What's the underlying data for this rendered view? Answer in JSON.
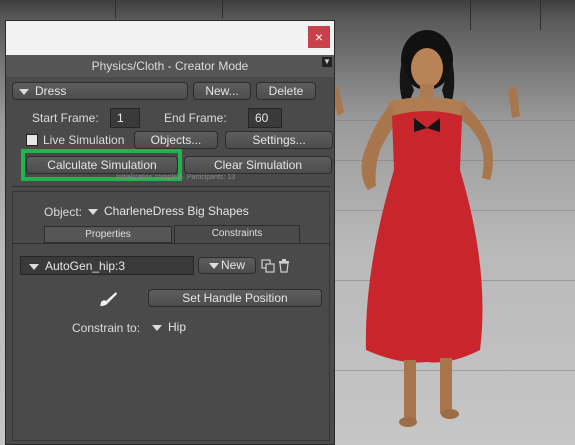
{
  "dialog": {
    "title": "Physics/Cloth - Creator Mode",
    "close_glyph": "×",
    "cloth_name": "Dress",
    "new_label": "New...",
    "delete_label": "Delete",
    "start_frame_label": "Start Frame:",
    "start_frame_value": "1",
    "end_frame_label": "End Frame:",
    "end_frame_value": "60",
    "live_simulation_label": "Live Simulation",
    "objects_label": "Objects...",
    "settings_label": "Settings...",
    "calculate_label": "Calculate Simulation",
    "clear_label": "Clear Simulation",
    "status_text": "Initialization complete. Participants: 13",
    "object_label": "Object:",
    "object_value": "CharleneDress Big Shapes",
    "tabs": [
      {
        "label": "Properties"
      },
      {
        "label": "Constraints"
      }
    ],
    "constraint_group": "AutoGen_hip:3",
    "constraint_new_label": "New",
    "set_handle_label": "Set Handle Position",
    "constrain_to_label": "Constrain to:",
    "constrain_to_value": "Hip"
  },
  "colors": {
    "highlight": "#22b34c",
    "close": "#c8404a",
    "dress": "#c8252d"
  }
}
